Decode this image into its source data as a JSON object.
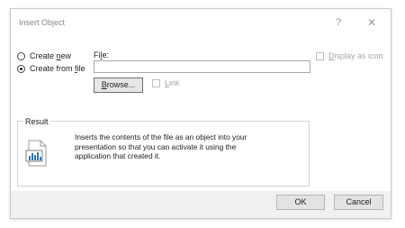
{
  "window": {
    "title": "Insert Object",
    "help_glyph": "?",
    "close_glyph": "✕"
  },
  "options": {
    "create_new": {
      "label_pre": "Create ",
      "label_key": "n",
      "label_post": "ew",
      "selected": false
    },
    "create_from_file": {
      "label_pre": "Create from ",
      "label_key": "f",
      "label_post": "ile",
      "selected": true
    }
  },
  "file": {
    "label_pre": "Fi",
    "label_key": "l",
    "label_post": "e:",
    "value": "",
    "browse_pre": "",
    "browse_key": "B",
    "browse_post": "rowse..."
  },
  "link": {
    "label_pre": "",
    "label_key": "L",
    "label_post": "ink",
    "checked": false,
    "enabled": false
  },
  "display_as_icon": {
    "label_pre": "",
    "label_key": "D",
    "label_post": "isplay as icon",
    "checked": false,
    "enabled": false
  },
  "result": {
    "label": "Result",
    "text": "Inserts the contents of the file as an object into your presentation so that you can activate it using the application that created it.",
    "icon": "document-chart-icon"
  },
  "buttons": {
    "ok": "OK",
    "cancel": "Cancel"
  },
  "colors": {
    "dialog_bg": "#ffffff",
    "footer_bg": "#f0f0f0",
    "disabled_text": "#a6a6a6",
    "icon_accent": "#2e75b6"
  }
}
